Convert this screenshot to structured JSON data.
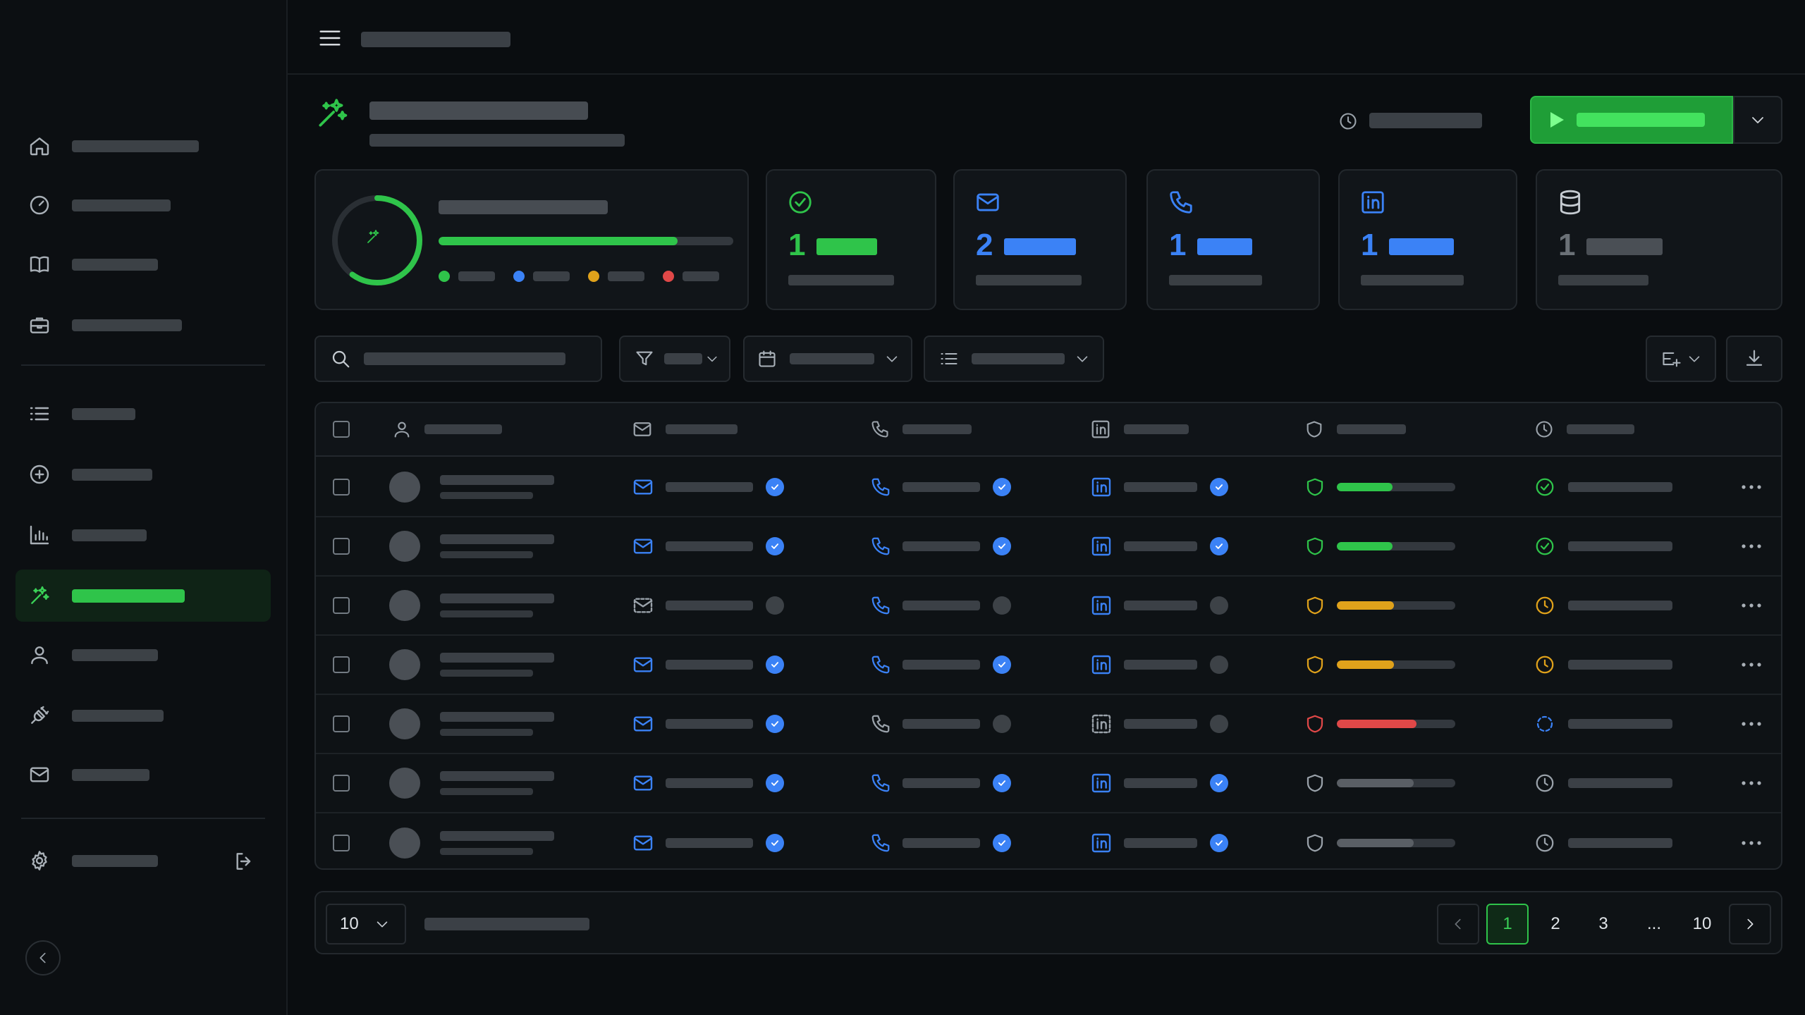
{
  "colors": {
    "accent": "#2fc44a",
    "blue": "#3b82f6",
    "amber": "#e0a21b",
    "red": "#e04848",
    "gray": "#9aa2aa"
  },
  "sidebar": {
    "items": [
      {
        "icon": "home-icon"
      },
      {
        "icon": "gauge-icon"
      },
      {
        "icon": "book-icon"
      },
      {
        "icon": "briefcase-icon"
      },
      {
        "icon": "list-icon"
      },
      {
        "icon": "plus-circle-icon"
      },
      {
        "icon": "bar-chart-icon"
      },
      {
        "icon": "sparkles-icon",
        "active": true
      },
      {
        "icon": "user-icon"
      },
      {
        "icon": "plug-icon"
      },
      {
        "icon": "mail-icon"
      }
    ],
    "footer": {
      "settings_icon": "gear-icon",
      "logout_icon": "logout-icon"
    },
    "collapse_icon": "chevron-left-icon"
  },
  "header": {
    "menu_icon": "hamburger-icon",
    "page_icon": "sparkles-icon",
    "clock_icon": "clock-icon",
    "run_icon": "play-icon",
    "run_menu_icon": "chevron-down-icon"
  },
  "summary": {
    "progress_ring": 0.6,
    "progress_bar": 0.81,
    "legend_colors": [
      "#2fc44a",
      "#3b82f6",
      "#e0a21b",
      "#e04848"
    ]
  },
  "stats": [
    {
      "icon": "check-circle-icon",
      "value": "1",
      "color": "#2fc44a"
    },
    {
      "icon": "mail-icon",
      "value": "2",
      "color": "#3b82f6"
    },
    {
      "icon": "phone-icon",
      "value": "1",
      "color": "#3b82f6"
    },
    {
      "icon": "linkedin-icon",
      "value": "1",
      "color": "#3b82f6"
    },
    {
      "icon": "database-icon",
      "value": "1",
      "color": "#6b7177"
    }
  ],
  "toolbar": {
    "search_icon": "search-icon",
    "filter_icon": "filter-icon",
    "date_icon": "calendar-icon",
    "list_icon": "list-icon",
    "columns_icon": "columns-add-icon",
    "download_icon": "download-icon"
  },
  "table": {
    "columns": [
      {
        "icon": "user-icon"
      },
      {
        "icon": "mail-icon"
      },
      {
        "icon": "phone-icon"
      },
      {
        "icon": "linkedin-icon"
      },
      {
        "icon": "shield-icon"
      },
      {
        "icon": "clock-icon"
      }
    ],
    "rows": [
      {
        "email": "ok",
        "email_v": true,
        "phone": "ok",
        "phone_v": true,
        "li": "ok",
        "li_v": true,
        "score": 0.47,
        "score_color": "#2fc44a",
        "status": "done"
      },
      {
        "email": "ok",
        "email_v": true,
        "phone": "ok",
        "phone_v": true,
        "li": "ok",
        "li_v": true,
        "score": 0.47,
        "score_color": "#2fc44a",
        "status": "done"
      },
      {
        "email": "pending",
        "email_v": false,
        "phone": "ok",
        "phone_v": false,
        "li": "ok",
        "li_v": false,
        "score": 0.48,
        "score_color": "#e0a21b",
        "status": "waiting"
      },
      {
        "email": "ok",
        "email_v": true,
        "phone": "ok",
        "phone_v": true,
        "li": "ok",
        "li_v": false,
        "score": 0.48,
        "score_color": "#e0a21b",
        "status": "waiting"
      },
      {
        "email": "ok",
        "email_v": true,
        "phone": "none",
        "phone_v": false,
        "li": "none",
        "li_v": false,
        "score": 0.67,
        "score_color": "#e04848",
        "status": "loading"
      },
      {
        "email": "ok",
        "email_v": true,
        "phone": "ok",
        "phone_v": true,
        "li": "ok",
        "li_v": true,
        "score": 0.65,
        "score_color": "#4a4f55",
        "status": "idle"
      },
      {
        "email": "ok",
        "email_v": true,
        "phone": "ok",
        "phone_v": true,
        "li": "ok",
        "li_v": true,
        "score": 0.65,
        "score_color": "#4a4f55",
        "status": "idle"
      }
    ]
  },
  "footer": {
    "page_size": "10",
    "pages": [
      "1",
      "2",
      "3",
      "...",
      "10"
    ],
    "current_page": "1"
  }
}
